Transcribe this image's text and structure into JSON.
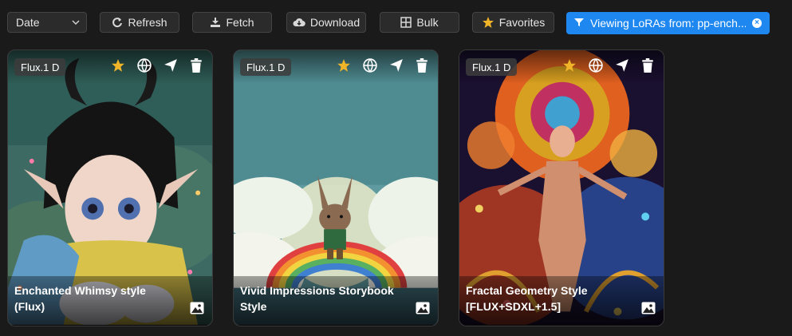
{
  "toolbar": {
    "sort_value": "Date",
    "refresh_label": "Refresh",
    "fetch_label": "Fetch",
    "download_label": "Download",
    "bulk_label": "Bulk",
    "favorites_label": "Favorites",
    "filter_text": "Viewing LoRAs from: pp-ench..."
  },
  "colors": {
    "accent": "#1e88f0",
    "star": "#f0b429",
    "background": "#1a1a1a"
  },
  "cards": [
    {
      "base_model": "Flux.1 D",
      "title_line1": "Enchanted Whimsy style",
      "title_line2": "(Flux)",
      "favorited": true
    },
    {
      "base_model": "Flux.1 D",
      "title_line1": "Vivid Impressions Storybook",
      "title_line2": "Style",
      "favorited": true
    },
    {
      "base_model": "Flux.1 D",
      "title_line1": "Fractal Geometry Style",
      "title_line2": "[FLUX+SDXL+1.5]",
      "favorited": true
    }
  ]
}
